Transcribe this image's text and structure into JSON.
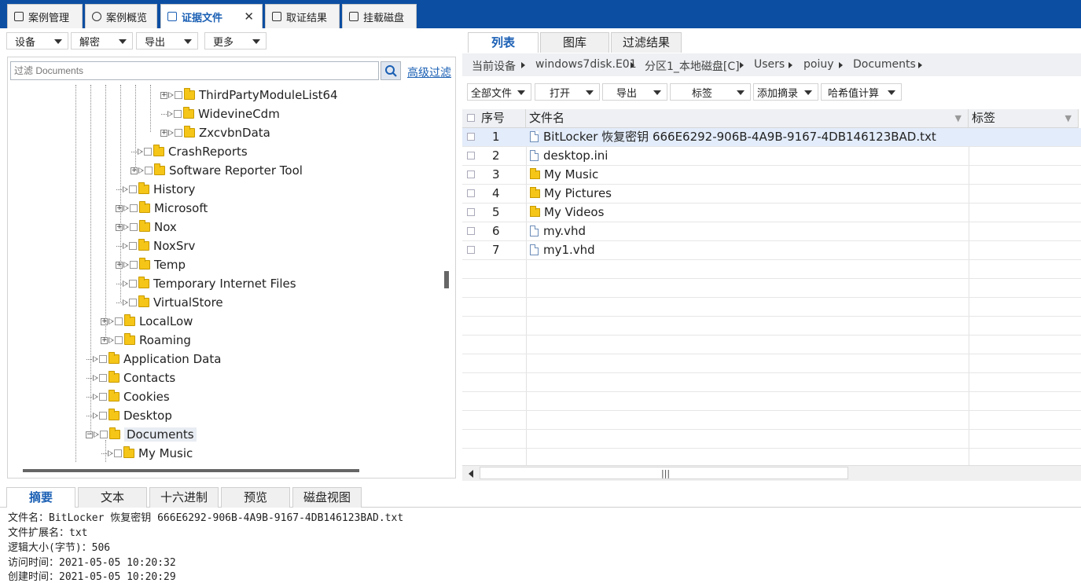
{
  "top_tabs": [
    {
      "label": "案例管理"
    },
    {
      "label": "案例概览"
    },
    {
      "label": "证据文件",
      "active": true
    },
    {
      "label": "取证结果"
    },
    {
      "label": "挂载磁盘"
    }
  ],
  "left_toolbar": {
    "device": "设备",
    "decrypt": "解密",
    "export": "导出",
    "more": "更多"
  },
  "filter": {
    "placeholder": "过滤 Documents",
    "advanced": "高级过滤"
  },
  "tree": [
    {
      "label": "ThirdPartyModuleList64",
      "expandable": true
    },
    {
      "label": "WidevineCdm",
      "expandable": false
    },
    {
      "label": "ZxcvbnData",
      "expandable": true
    },
    {
      "label": "CrashReports",
      "expandable": false
    },
    {
      "label": "Software Reporter Tool",
      "expandable": true
    },
    {
      "label": "History",
      "expandable": false
    },
    {
      "label": "Microsoft",
      "expandable": true
    },
    {
      "label": "Nox",
      "expandable": true
    },
    {
      "label": "NoxSrv",
      "expandable": false
    },
    {
      "label": "Temp",
      "expandable": true
    },
    {
      "label": "Temporary Internet Files",
      "expandable": false
    },
    {
      "label": "VirtualStore",
      "expandable": false
    },
    {
      "label": "LocalLow",
      "expandable": true
    },
    {
      "label": "Roaming",
      "expandable": true
    },
    {
      "label": "Application Data",
      "expandable": false
    },
    {
      "label": "Contacts",
      "expandable": false
    },
    {
      "label": "Cookies",
      "expandable": false
    },
    {
      "label": "Desktop",
      "expandable": false
    },
    {
      "label": "Documents",
      "expandable": true,
      "expanded": true,
      "selected": true
    },
    {
      "label": "My Music",
      "expandable": false
    }
  ],
  "right_tabs": [
    {
      "label": "列表",
      "active": true
    },
    {
      "label": "图库"
    },
    {
      "label": "过滤结果"
    }
  ],
  "breadcrumb": [
    "当前设备",
    "windows7disk.E01",
    "分区1_本地磁盘[C]",
    "Users",
    "poiuy",
    "Documents"
  ],
  "right_toolbar": {
    "all_files": "全部文件",
    "open": "打开",
    "export": "导出",
    "tag": "标签",
    "add_summary": "添加摘录",
    "hash": "哈希值计算"
  },
  "grid": {
    "columns": {
      "index": "序号",
      "name": "文件名",
      "tag": "标签"
    },
    "rows": [
      {
        "index": "1",
        "name": "BitLocker 恢复密钥 666E6292-906B-4A9B-9167-4DB146123BAD.txt",
        "type": "file",
        "selected": true
      },
      {
        "index": "2",
        "name": "desktop.ini",
        "type": "file"
      },
      {
        "index": "3",
        "name": "My Music",
        "type": "folder"
      },
      {
        "index": "4",
        "name": "My Pictures",
        "type": "folder"
      },
      {
        "index": "5",
        "name": "My Videos",
        "type": "folder"
      },
      {
        "index": "6",
        "name": "my.vhd",
        "type": "file"
      },
      {
        "index": "7",
        "name": "my1.vhd",
        "type": "file"
      }
    ]
  },
  "bottom_tabs": [
    {
      "label": "摘要",
      "active": true
    },
    {
      "label": "文本"
    },
    {
      "label": "十六进制"
    },
    {
      "label": "预览"
    },
    {
      "label": "磁盘视图"
    }
  ],
  "summary": [
    "文件名：BitLocker 恢复密钥 666E6292-906B-4A9B-9167-4DB146123BAD.txt",
    "文件扩展名：txt",
    "逻辑大小(字节)：506",
    "访问时间：2021-05-05 10:20:32",
    "创建时间：2021-05-05 10:20:29"
  ],
  "colors": {
    "accent": "#1a5fb4",
    "topbar": "#0c4ea2"
  }
}
